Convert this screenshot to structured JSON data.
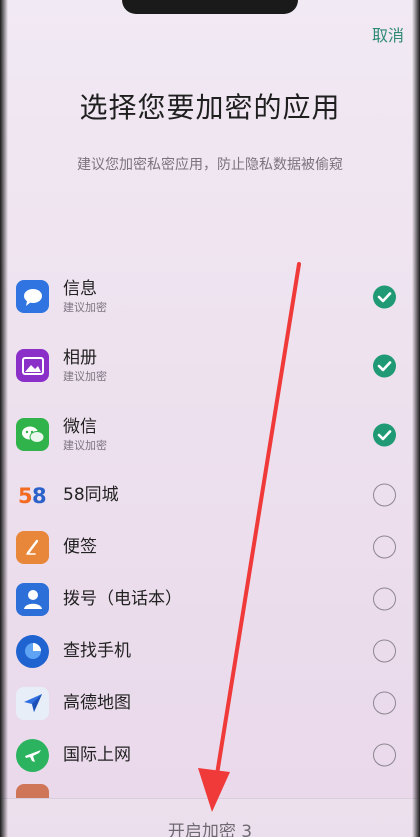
{
  "header": {
    "cancel_label": "取消",
    "title": "选择您要加密的应用",
    "subtitle": "建议您加密私密应用，防止隐私数据被偷窥"
  },
  "apps": [
    {
      "name": "信息",
      "sub": "建议加密",
      "checked": true,
      "icon": "message-icon",
      "color": "#2f74e0"
    },
    {
      "name": "相册",
      "sub": "建议加密",
      "checked": true,
      "icon": "gallery-icon",
      "color": "#8b2fc9"
    },
    {
      "name": "微信",
      "sub": "建议加密",
      "checked": true,
      "icon": "wechat-icon",
      "color": "#2fb34a"
    },
    {
      "name": "58同城",
      "sub": "",
      "checked": false,
      "icon": "58-logo-icon",
      "color": "#e53935"
    },
    {
      "name": "便签",
      "sub": "",
      "checked": false,
      "icon": "notes-icon",
      "color": "#e8873a"
    },
    {
      "name": "拨号（电话本）",
      "sub": "",
      "checked": false,
      "icon": "contacts-icon",
      "color": "#2d6fd8"
    },
    {
      "name": "查找手机",
      "sub": "",
      "checked": false,
      "icon": "find-phone-icon",
      "color": "#1f63d1"
    },
    {
      "name": "高德地图",
      "sub": "",
      "checked": false,
      "icon": "amap-icon",
      "color": "#3a7be6"
    },
    {
      "name": "国际上网",
      "sub": "",
      "checked": false,
      "icon": "roaming-icon",
      "color": "#2bb35f"
    }
  ],
  "footer": {
    "action_label": "开启加密 3"
  },
  "colors": {
    "accent": "#1f9a74",
    "cancel": "#2e8a76",
    "annotation_arrow": "#f03a3a"
  }
}
